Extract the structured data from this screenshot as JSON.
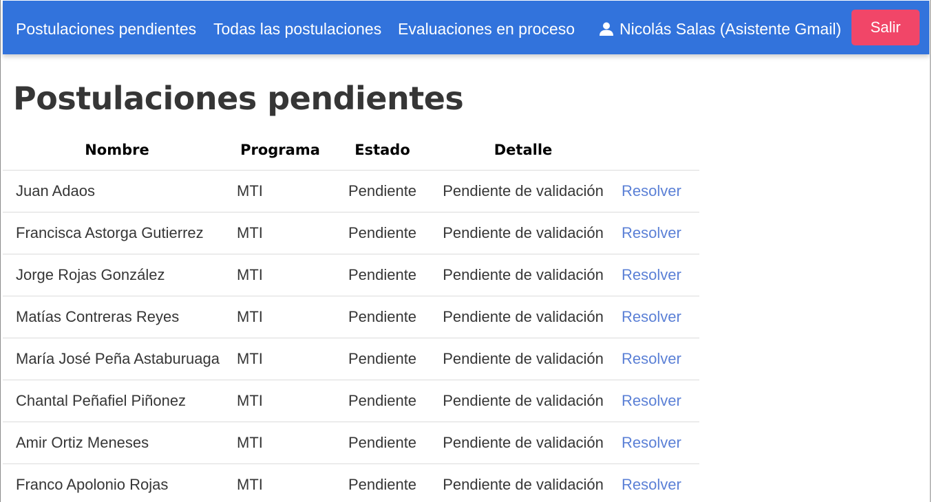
{
  "navbar": {
    "links": [
      {
        "label": "Postulaciones pendientes"
      },
      {
        "label": "Todas las postulaciones"
      },
      {
        "label": "Evaluaciones en proceso"
      }
    ],
    "user": {
      "label": "Nicolás Salas (Asistente Gmail)",
      "icon": "user-icon"
    },
    "logout_label": "Salir",
    "colors": {
      "navbar": "#3273dc",
      "logout": "#f14668",
      "link": "#5b80d6"
    }
  },
  "main": {
    "title": "Postulaciones pendientes",
    "table": {
      "headers": {
        "name": "Nombre",
        "program": "Programa",
        "state": "Estado",
        "detail": "Detalle"
      },
      "action_label": "Resolver",
      "rows": [
        {
          "name": "Juan Adaos",
          "program": "MTI",
          "state": "Pendiente",
          "detail": "Pendiente de validación",
          "action": "Resolver"
        },
        {
          "name": "Francisca Astorga Gutierrez",
          "program": "MTI",
          "state": "Pendiente",
          "detail": "Pendiente de validación",
          "action": "Resolver"
        },
        {
          "name": "Jorge Rojas González",
          "program": "MTI",
          "state": "Pendiente",
          "detail": "Pendiente de validación",
          "action": "Resolver"
        },
        {
          "name": "Matías Contreras Reyes",
          "program": "MTI",
          "state": "Pendiente",
          "detail": "Pendiente de validación",
          "action": "Resolver"
        },
        {
          "name": "María José Peña Astaburuaga",
          "program": "MTI",
          "state": "Pendiente",
          "detail": "Pendiente de validación",
          "action": "Resolver"
        },
        {
          "name": "Chantal Peñafiel Piñonez",
          "program": "MTI",
          "state": "Pendiente",
          "detail": "Pendiente de validación",
          "action": "Resolver"
        },
        {
          "name": "Amir Ortiz Meneses",
          "program": "MTI",
          "state": "Pendiente",
          "detail": "Pendiente de validación",
          "action": "Resolver"
        },
        {
          "name": "Franco Apolonio Rojas",
          "program": "MTI",
          "state": "Pendiente",
          "detail": "Pendiente de validación",
          "action": "Resolver"
        }
      ]
    }
  }
}
